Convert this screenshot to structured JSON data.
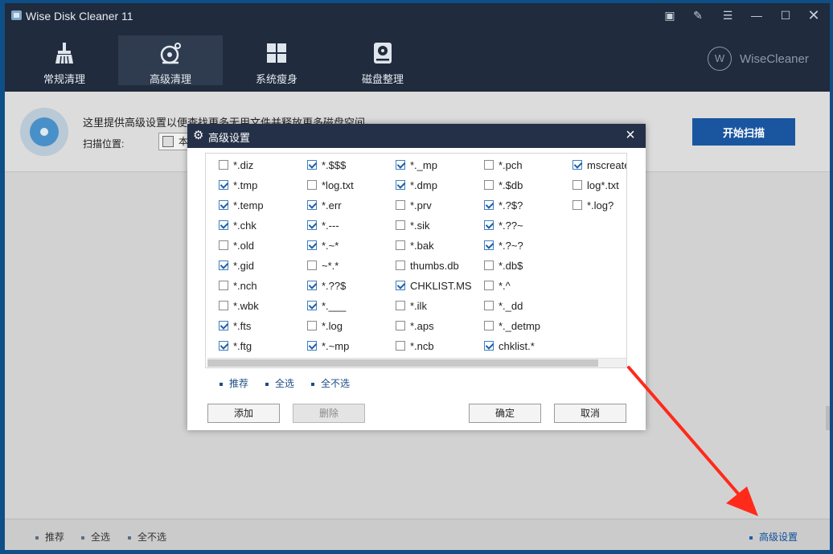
{
  "window": {
    "title": "Wise Disk Cleaner 11",
    "controls": [
      "feedback-icon",
      "edit-icon",
      "menu-icon",
      "minimize-icon",
      "maximize-icon",
      "close-icon"
    ]
  },
  "nav": {
    "tabs": [
      {
        "label": "常规清理",
        "icon": "broom-icon",
        "active": false
      },
      {
        "label": "高级清理",
        "icon": "advanced-clean-icon",
        "active": true
      },
      {
        "label": "系统瘦身",
        "icon": "windows-icon",
        "active": false
      },
      {
        "label": "磁盘整理",
        "icon": "disk-defrag-icon",
        "active": false
      }
    ],
    "brand": "WiseCleaner",
    "brand_mark": "W"
  },
  "info": {
    "description": "这里提供高级设置以便查找更多无用文件并释放更多磁盘空间。",
    "scan_location_label": "扫描位置:",
    "scan_location_value": "本",
    "start_scan": "开始扫描"
  },
  "footer": {
    "recommend": "推荐",
    "select_all": "全选",
    "select_none": "全不选",
    "advanced_settings": "高级设置"
  },
  "dialog": {
    "title": "高级设置",
    "columns": [
      [
        {
          "label": "*.diz",
          "checked": false
        },
        {
          "label": "*.tmp",
          "checked": true
        },
        {
          "label": "*.temp",
          "checked": true
        },
        {
          "label": "*.chk",
          "checked": true
        },
        {
          "label": "*.old",
          "checked": false
        },
        {
          "label": "*.gid",
          "checked": true
        },
        {
          "label": "*.nch",
          "checked": false
        },
        {
          "label": "*.wbk",
          "checked": false
        },
        {
          "label": "*.fts",
          "checked": true
        },
        {
          "label": "*.ftg",
          "checked": true
        }
      ],
      [
        {
          "label": "*.$$$",
          "checked": true
        },
        {
          "label": "*log.txt",
          "checked": false
        },
        {
          "label": "*.err",
          "checked": true
        },
        {
          "label": "*.---",
          "checked": true
        },
        {
          "label": "*.~*",
          "checked": true
        },
        {
          "label": "~*.*",
          "checked": false
        },
        {
          "label": "*.??$",
          "checked": true
        },
        {
          "label": "*.___",
          "checked": true
        },
        {
          "label": "*.log",
          "checked": false
        },
        {
          "label": "*.~mp",
          "checked": true
        }
      ],
      [
        {
          "label": "*._mp",
          "checked": true
        },
        {
          "label": "*.dmp",
          "checked": true
        },
        {
          "label": "*.prv",
          "checked": false
        },
        {
          "label": "*.sik",
          "checked": false
        },
        {
          "label": "*.bak",
          "checked": false
        },
        {
          "label": "thumbs.db",
          "checked": false
        },
        {
          "label": "CHKLIST.MS",
          "checked": true
        },
        {
          "label": "*.ilk",
          "checked": false
        },
        {
          "label": "*.aps",
          "checked": false
        },
        {
          "label": "*.ncb",
          "checked": false
        }
      ],
      [
        {
          "label": "*.pch",
          "checked": false
        },
        {
          "label": "*.$db",
          "checked": false
        },
        {
          "label": "*.?$?",
          "checked": true
        },
        {
          "label": "*.??~",
          "checked": true
        },
        {
          "label": "*.?~?",
          "checked": true
        },
        {
          "label": "*.db$",
          "checked": false
        },
        {
          "label": "*.^",
          "checked": false
        },
        {
          "label": "*._dd",
          "checked": false
        },
        {
          "label": "*._detmp",
          "checked": false
        },
        {
          "label": "chklist.*",
          "checked": true
        }
      ],
      [
        {
          "label": "mscreate.dir",
          "checked": true
        },
        {
          "label": "log*.txt",
          "checked": false
        },
        {
          "label": "*.log?",
          "checked": false
        }
      ]
    ],
    "links": {
      "recommend": "推荐",
      "select_all": "全选",
      "select_none": "全不选"
    },
    "buttons": {
      "add": "添加",
      "delete": "删除",
      "ok": "确定",
      "cancel": "取消"
    }
  },
  "colors": {
    "titlebar": "#202b3d",
    "accent": "#1a56a0",
    "arrow": "#ff2a1a"
  }
}
